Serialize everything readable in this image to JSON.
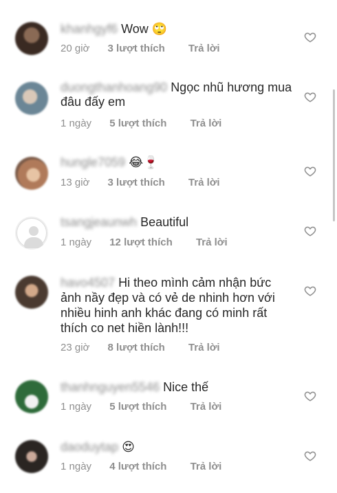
{
  "comments": [
    {
      "username": "khanhgyf6",
      "text": "Wow 🙄",
      "time": "20 giờ",
      "likes": "3 lượt thích",
      "reply": "Trả lời",
      "avatar_color": "#3a2a22"
    },
    {
      "username": "duongthanhoang90",
      "text": "Ngọc nhũ hương mua đâu đấy em",
      "time": "1 ngày",
      "likes": "5 lượt thích",
      "reply": "Trả lời",
      "avatar_color": "#6b8696"
    },
    {
      "username": "hungle7059",
      "text": "😂🍷",
      "time": "13 giờ",
      "likes": "3 lượt thích",
      "reply": "Trả lời",
      "avatar_color": "#b07a5a"
    },
    {
      "username": "tsangjeaunwh",
      "text": "Beautiful",
      "time": "1 ngày",
      "likes": "12 lượt thích",
      "reply": "Trả lời",
      "avatar_color": "#efefef"
    },
    {
      "username": "havo4507",
      "text": "Hi theo mình cảm nhận bức ảnh nầy đẹp và có vẻ de nhinh hơn với nhiều hinh  anh khác đang có minh rất thích co net hiền lành!!!",
      "time": "23 giờ",
      "likes": "8 lượt thích",
      "reply": "Trả lời",
      "avatar_color": "#4a3a30"
    },
    {
      "username": "thanhnguyen5546",
      "text": "Nice thế",
      "time": "1 ngày",
      "likes": "5 lượt thích",
      "reply": "Trả lời",
      "avatar_color": "#2e6b3a"
    },
    {
      "username": "daoduytap",
      "text": "😍",
      "time": "1 ngày",
      "likes": "4 lượt thích",
      "reply": "Trả lời",
      "avatar_color": "#2a2522"
    }
  ],
  "colors": {
    "text": "#262626",
    "meta": "#8e8e8e",
    "heart_stroke": "#8e8e8e"
  }
}
